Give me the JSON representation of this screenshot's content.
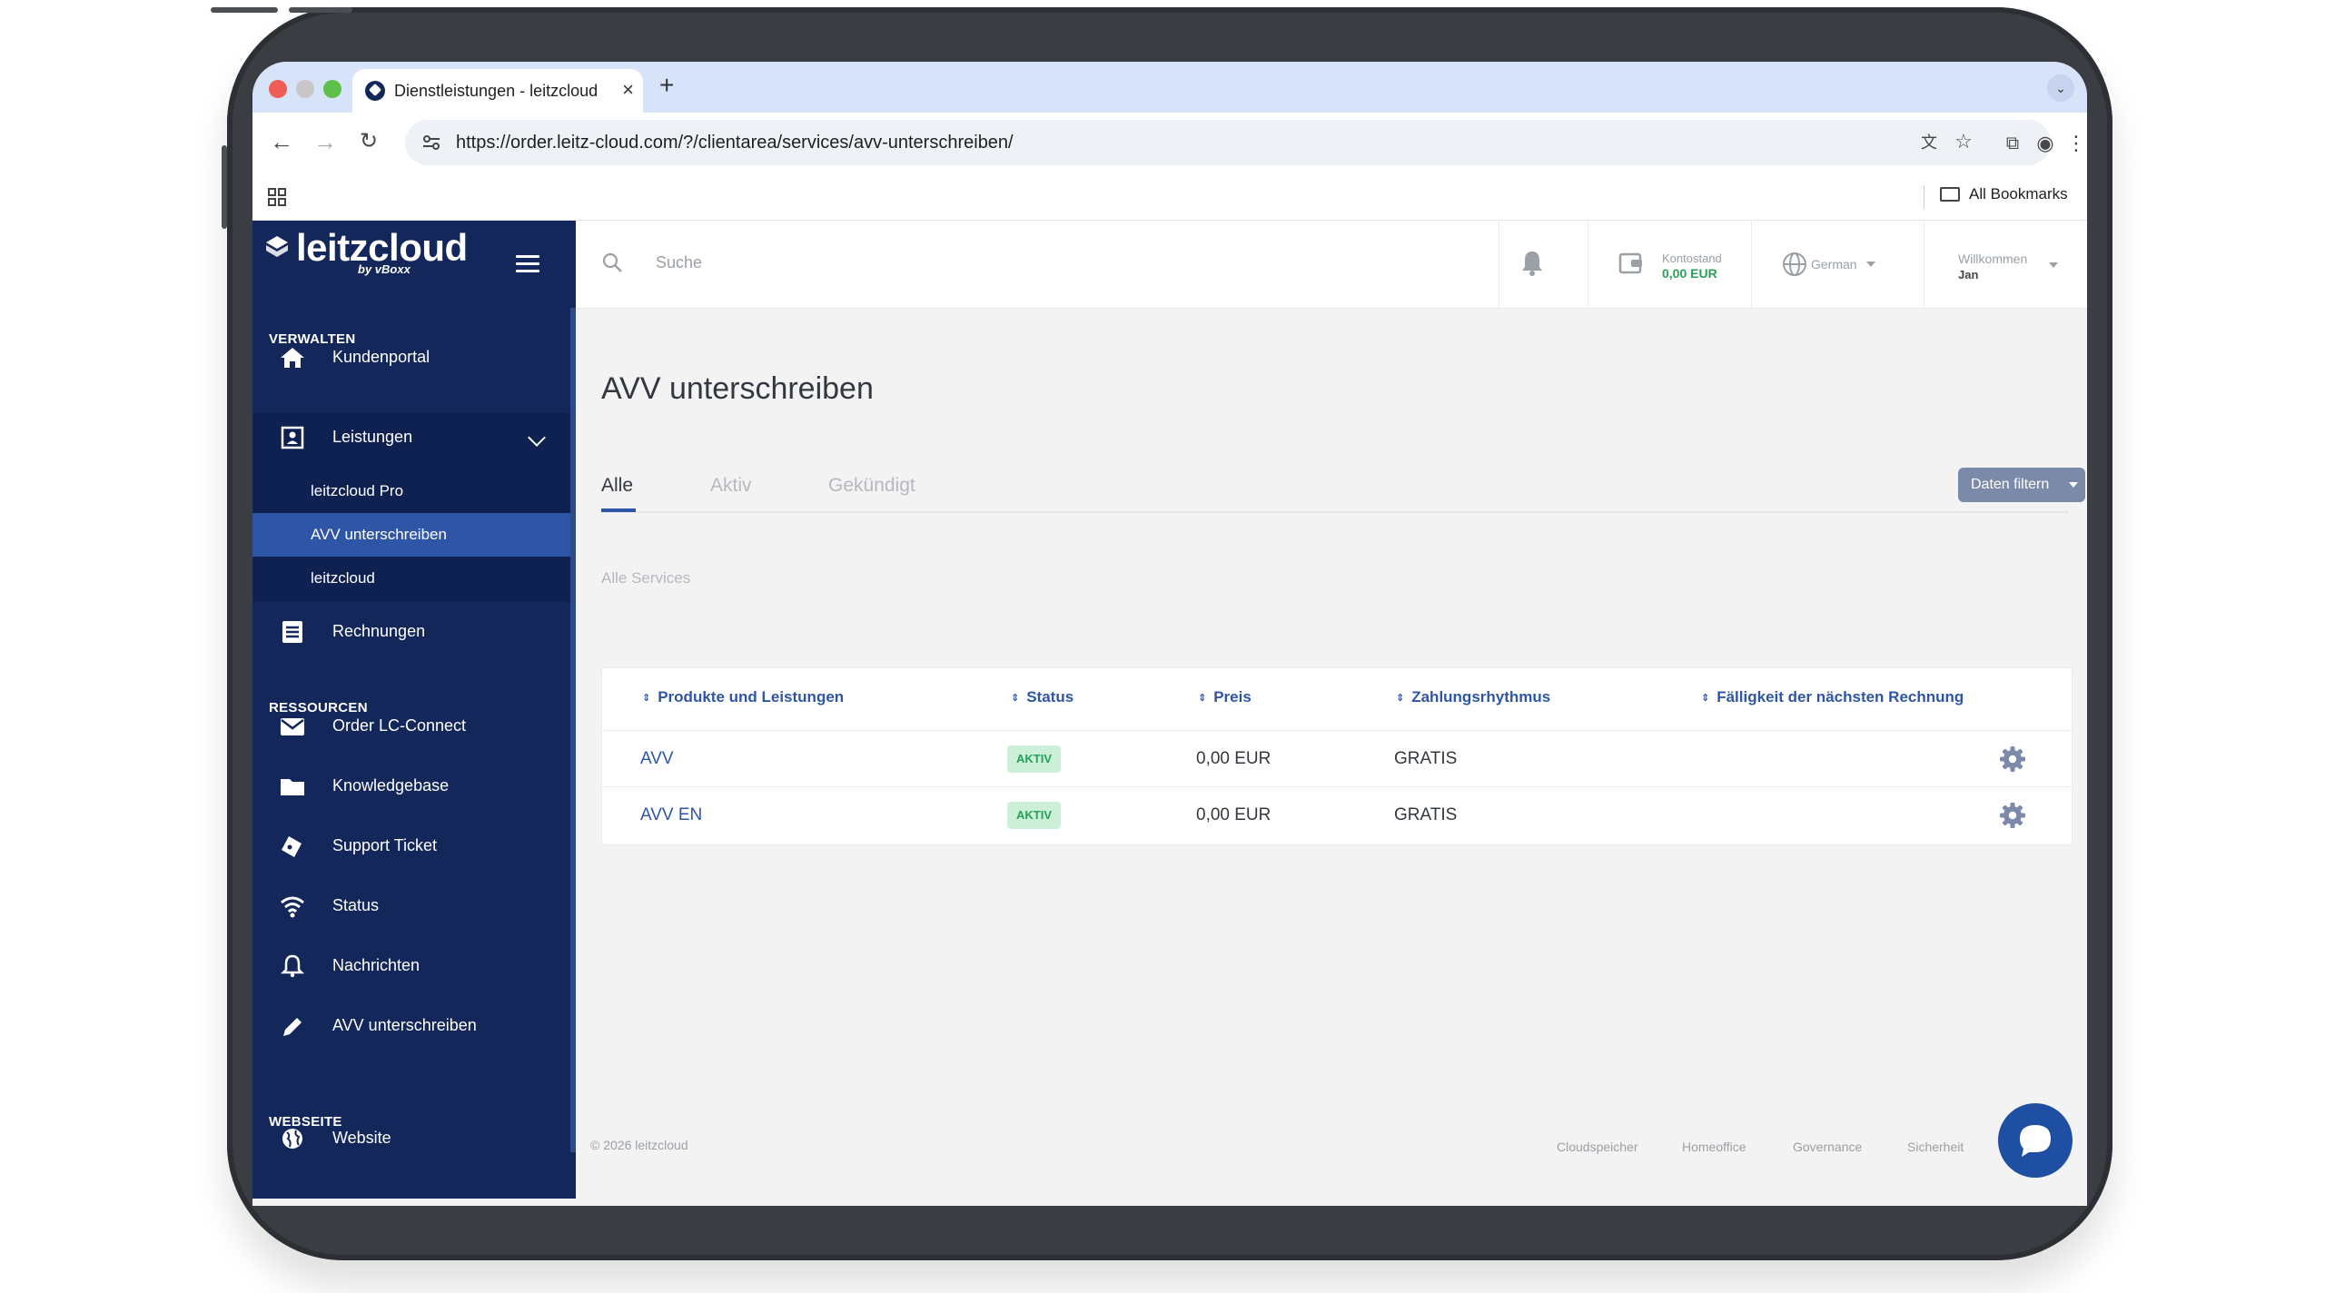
{
  "browser": {
    "tab_title": "Dienstleistungen - leitzcloud",
    "url": "https://order.leitz-cloud.com/?/clientarea/services/avv-unterschreiben/",
    "bookmarks_label": "All Bookmarks"
  },
  "brand": {
    "name": "leitzcloud",
    "sub": "by vBoxx"
  },
  "sidebar": {
    "section_manage": "VERWALTEN",
    "section_resources": "RESSOURCEN",
    "section_website": "WEBSEITE",
    "items": [
      {
        "label": "Kundenportal",
        "icon": "home-icon"
      },
      {
        "label": "Leistungen",
        "icon": "services-icon"
      },
      {
        "label": "Rechnungen",
        "icon": "invoice-icon"
      },
      {
        "label": "Order LC-Connect",
        "icon": "envelope-icon"
      },
      {
        "label": "Knowledgebase",
        "icon": "folder-icon"
      },
      {
        "label": "Support Ticket",
        "icon": "ticket-icon"
      },
      {
        "label": "Status",
        "icon": "wifi-icon"
      },
      {
        "label": "Nachrichten",
        "icon": "bell-icon"
      },
      {
        "label": "AVV unterschreiben",
        "icon": "pencil-icon"
      },
      {
        "label": "Website",
        "icon": "globe-icon"
      }
    ],
    "subitems": [
      {
        "label": "leitzcloud Pro"
      },
      {
        "label": "AVV unterschreiben",
        "active": true
      },
      {
        "label": "leitzcloud"
      }
    ]
  },
  "topbar": {
    "search_placeholder": "Suche",
    "balance_label": "Kontostand",
    "balance_value": "0,00 EUR",
    "language": "German",
    "welcome_label": "Willkommen",
    "welcome_name": "Jan"
  },
  "main": {
    "title": "AVV unterschreiben",
    "tabs": [
      "Alle",
      "Aktiv",
      "Gekündigt"
    ],
    "active_tab": "Alle",
    "filter_button": "Daten filtern",
    "section_label": "Alle Services",
    "table": {
      "headers": [
        "Produkte und Leistungen",
        "Status",
        "Preis",
        "Zahlungsrhythmus",
        "Fälligkeit der nächsten Rechnung"
      ],
      "rows": [
        {
          "product": "AVV",
          "status": "AKTIV",
          "price": "0,00 EUR",
          "cycle": "GRATIS",
          "due": ""
        },
        {
          "product": "AVV EN",
          "status": "AKTIV",
          "price": "0,00 EUR",
          "cycle": "GRATIS",
          "due": ""
        }
      ]
    }
  },
  "footer": {
    "copyright": "© 2026 leitzcloud",
    "links": [
      "Cloudspeicher",
      "Homeoffice",
      "Governance",
      "Sicherheit"
    ]
  },
  "colors": {
    "sidebar_bg": "#13275a",
    "accent": "#2f56a6",
    "success": "#27a05a",
    "chat_button": "#1f4fa3"
  }
}
